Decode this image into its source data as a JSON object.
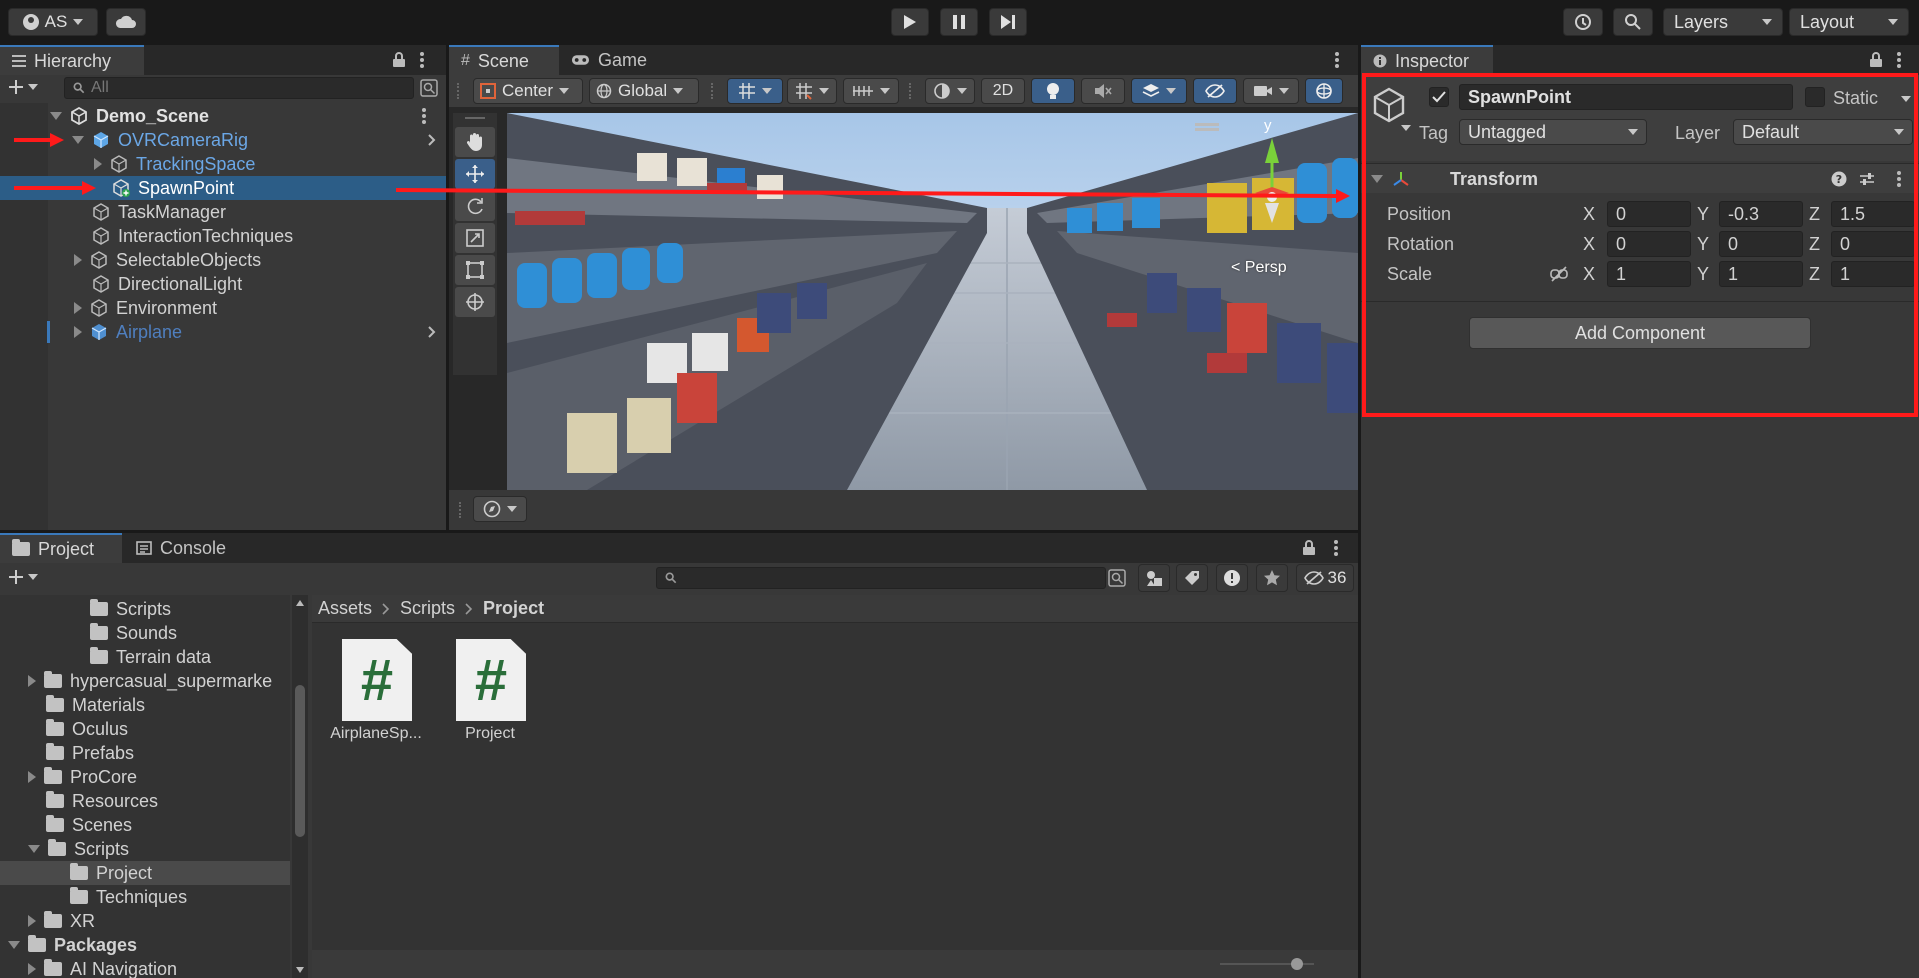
{
  "account": {
    "initials": "AS"
  },
  "toolbar": {
    "layers_label": "Layers",
    "layout_label": "Layout"
  },
  "hierarchy": {
    "tab": "Hierarchy",
    "search_placeholder": "All",
    "scene_name": "Demo_Scene",
    "items": [
      {
        "label": "OVRCameraRig",
        "color": "#6ba7e6"
      },
      {
        "label": "TrackingSpace",
        "color": "#6ba7e6"
      },
      {
        "label": "SpawnPoint",
        "color": "#ffffff"
      },
      {
        "label": "TaskManager",
        "color": "#d2d2d2"
      },
      {
        "label": "InteractionTechniques",
        "color": "#d2d2d2"
      },
      {
        "label": "SelectableObjects",
        "color": "#d2d2d2"
      },
      {
        "label": "DirectionalLight",
        "color": "#d2d2d2"
      },
      {
        "label": "Environment",
        "color": "#d2d2d2"
      },
      {
        "label": "Airplane",
        "color": "#4f7fbf"
      }
    ]
  },
  "scene": {
    "tab_scene": "Scene",
    "tab_game": "Game",
    "pivot_label": "Center",
    "space_label": "Global",
    "mode_2d": "2D",
    "persp_label": "< Persp",
    "gizmo_axis": "y"
  },
  "inspector": {
    "tab": "Inspector",
    "object_name": "SpawnPoint",
    "static_label": "Static",
    "tag_label": "Tag",
    "tag_value": "Untagged",
    "layer_label": "Layer",
    "layer_value": "Default",
    "transform_title": "Transform",
    "axis_x": "X",
    "axis_y": "Y",
    "axis_z": "Z",
    "position": {
      "label": "Position",
      "x": "0",
      "y": "-0.3",
      "z": "1.5"
    },
    "rotation": {
      "label": "Rotation",
      "x": "0",
      "y": "0",
      "z": "0"
    },
    "scale": {
      "label": "Scale",
      "x": "1",
      "y": "1",
      "z": "1"
    },
    "add_component": "Add Component"
  },
  "project": {
    "tab_project": "Project",
    "tab_console": "Console",
    "hidden_count": "36",
    "breadcrumb": [
      "Assets",
      "Scripts",
      "Project"
    ],
    "tree": [
      {
        "label": "Scripts",
        "expand": "none",
        "selected": false,
        "bold": false
      },
      {
        "label": "Sounds",
        "expand": "none",
        "selected": false,
        "bold": false
      },
      {
        "label": "Terrain data",
        "expand": "none",
        "selected": false,
        "bold": false
      },
      {
        "label": "hypercasual_supermarke",
        "expand": "collapsed",
        "selected": false,
        "bold": false
      },
      {
        "label": "Materials",
        "expand": "none",
        "selected": false,
        "bold": false
      },
      {
        "label": "Oculus",
        "expand": "none",
        "selected": false,
        "bold": false
      },
      {
        "label": "Prefabs",
        "expand": "none",
        "selected": false,
        "bold": false
      },
      {
        "label": "ProCore",
        "expand": "collapsed",
        "selected": false,
        "bold": false
      },
      {
        "label": "Resources",
        "expand": "none",
        "selected": false,
        "bold": false
      },
      {
        "label": "Scenes",
        "expand": "none",
        "selected": false,
        "bold": false
      },
      {
        "label": "Scripts",
        "expand": "expanded",
        "selected": false,
        "bold": false
      },
      {
        "label": "Project",
        "expand": "none",
        "selected": true,
        "bold": false
      },
      {
        "label": "Techniques",
        "expand": "none",
        "selected": false,
        "bold": false
      },
      {
        "label": "XR",
        "expand": "collapsed",
        "selected": false,
        "bold": false
      },
      {
        "label": "Packages",
        "expand": "expanded",
        "selected": false,
        "bold": true
      },
      {
        "label": "AI Navigation",
        "expand": "collapsed",
        "selected": false,
        "bold": false
      }
    ],
    "assets": [
      {
        "name": "AirplaneSp...",
        "glyph": "#"
      },
      {
        "name": "Project",
        "glyph": "#"
      }
    ]
  },
  "colors": {
    "accent": "#3a79bb",
    "selection": "#2c5d87",
    "annotation": "#ff1a1a",
    "script_icon": "#2a6e3a"
  }
}
